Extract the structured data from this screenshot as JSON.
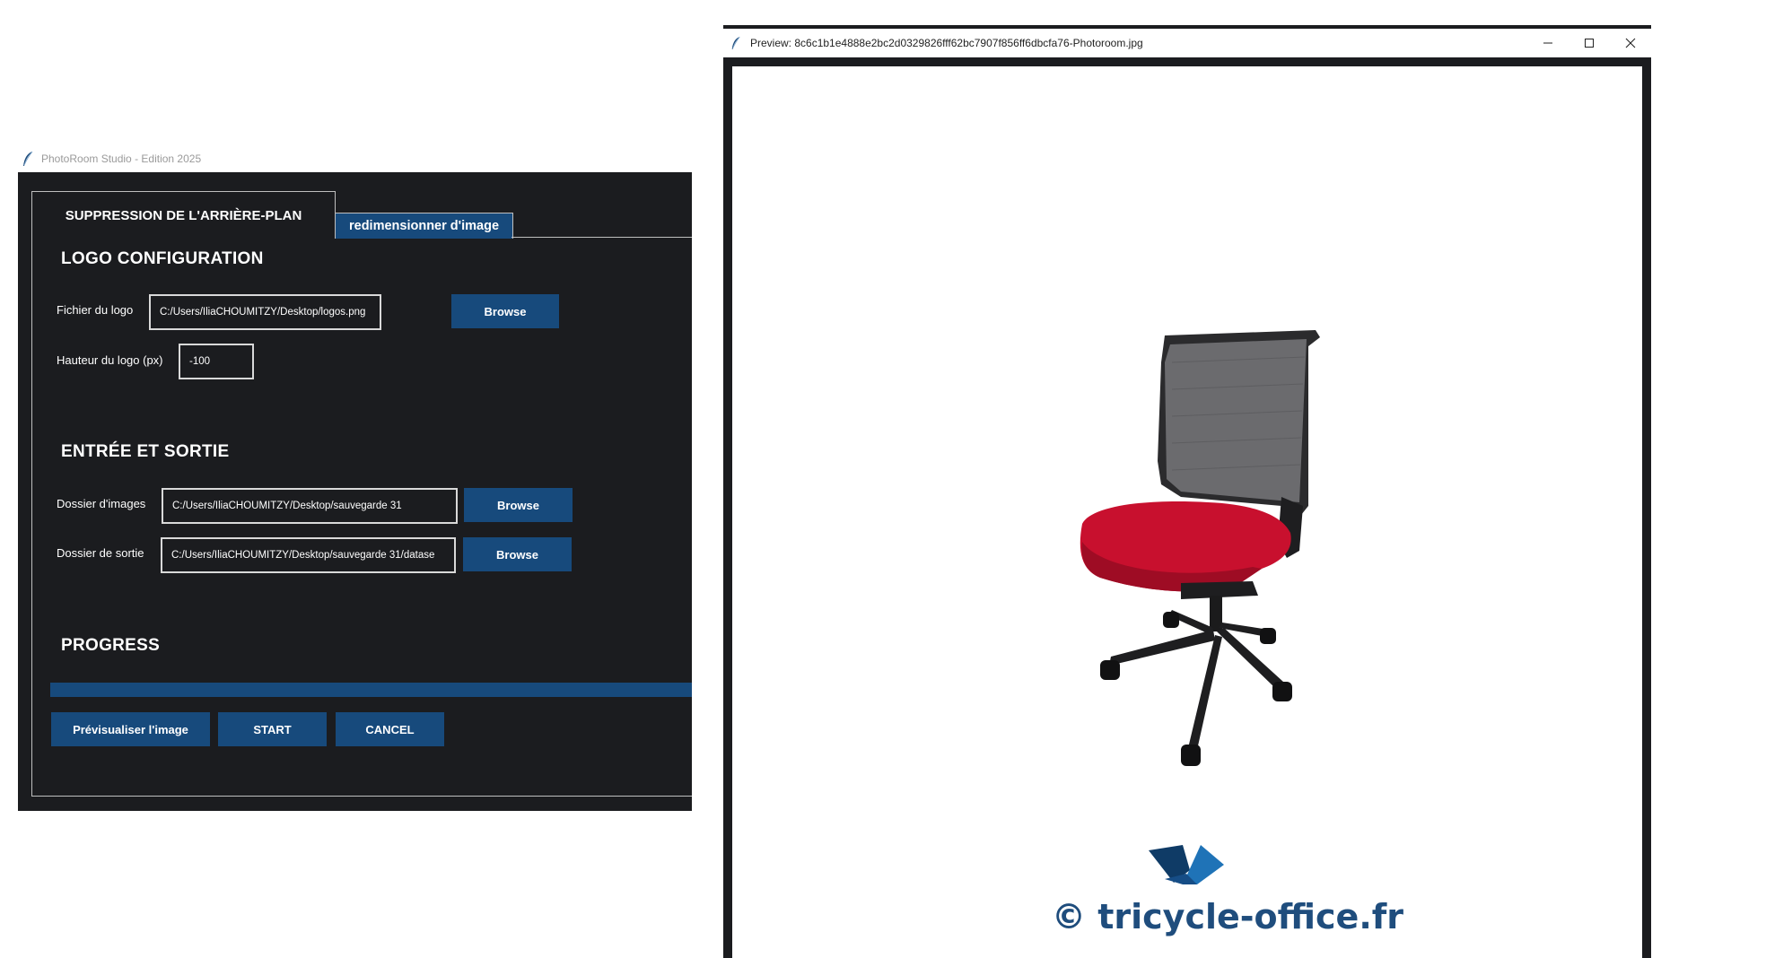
{
  "app": {
    "title": "PhotoRoom Studio - Edition 2025",
    "tabs": [
      {
        "label": "SUPPRESSION DE L'ARRIÈRE-PLAN"
      },
      {
        "label": "redimensionner d'image"
      }
    ],
    "logo_section": {
      "title": "LOGO CONFIGURATION",
      "logo_file_label": "Fichier du logo",
      "logo_file_value": "C:/Users/IliaCHOUMITZY/Desktop/logos.png",
      "logo_height_label": "Hauteur du logo (px)",
      "logo_height_value": "-100",
      "browse_label": "Browse"
    },
    "io_section": {
      "title": "ENTRÉE ET SORTIE",
      "input_dir_label": "Dossier d'images",
      "input_dir_value": "C:/Users/IliaCHOUMITZY/Desktop/sauvegarde 31",
      "output_dir_label": "Dossier de sortie",
      "output_dir_value": "C:/Users/IliaCHOUMITZY/Desktop/sauvegarde 31/datase",
      "browse_label": "Browse"
    },
    "progress_section": {
      "title": "PROGRESS",
      "progress": 1.0
    },
    "actions": {
      "preview_label": "Prévisualiser l'image",
      "start_label": "START",
      "cancel_label": "CANCEL"
    }
  },
  "preview": {
    "title": "Preview: 8c6c1b1e4888e2bc2d0329826fff62bc7907f856ff6dbcfa76-Photoroom.jpg",
    "watermark": "© tricycle-office.fr",
    "controls": [
      "minimize-icon",
      "maximize-icon",
      "close-icon"
    ]
  },
  "colors": {
    "accent": "#174a7c",
    "panel_bg": "#1b1c1f",
    "seat_red": "#c8102e",
    "logo_blue": "#1f5c96"
  }
}
